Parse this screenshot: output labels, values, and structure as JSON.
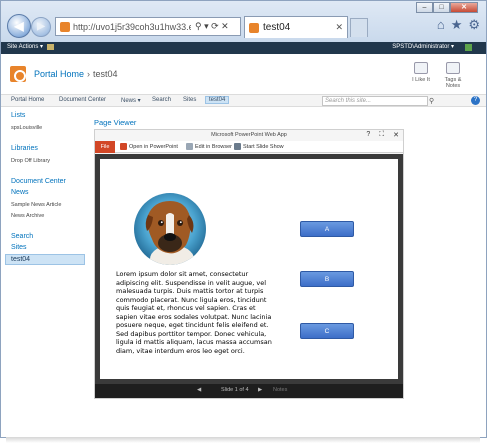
{
  "browser": {
    "url": "http://uvo1j5r39coh3u1hw33.env.c...",
    "address_icons": "⚲ ▾ ⟳ ✕",
    "tab_title": "test04",
    "window_buttons": [
      "–",
      "□",
      "✕"
    ],
    "icons": [
      "home-icon",
      "star-icon",
      "gear-icon"
    ]
  },
  "sp_topbar": {
    "site_actions": "Site Actions ▾",
    "user": "SPSTD\\Administrator ▾"
  },
  "title_area": {
    "site_title": "Portal Home",
    "separator": "›",
    "current_page": "test04",
    "ribbon_buttons": [
      {
        "label": "I Like It"
      },
      {
        "label": "Tags & Notes"
      }
    ]
  },
  "top_nav": {
    "items": [
      "Portal Home",
      "Document Center",
      "News ▾",
      "Search",
      "Sites",
      "test04"
    ],
    "selected": "test04",
    "search_placeholder": "Search this site...",
    "help": "?"
  },
  "quick_launch": {
    "sections": [
      {
        "heading": "Lists",
        "items": [
          "spsLouisville"
        ]
      },
      {
        "heading": "Libraries",
        "items": [
          "Drop Off Library"
        ]
      },
      {
        "heading": "Document Center",
        "items": []
      },
      {
        "heading": "News",
        "items": [
          "Sample News Article",
          "News Archive"
        ]
      },
      {
        "heading": "Search",
        "items": []
      },
      {
        "heading": "Sites",
        "items": []
      }
    ],
    "selected": "test04"
  },
  "web_part": {
    "title": "Page Viewer",
    "app_title": "Microsoft PowerPoint Web App",
    "header_icons": [
      "?",
      "⛶",
      "✕"
    ],
    "toolbar": {
      "file": "File",
      "open_in_powerpoint": "Open in PowerPoint",
      "edit_in_browser": "Edit in Browser",
      "start_slide_show": "Start Slide Show"
    },
    "slide": {
      "text": "Lorem ipsum dolor sit amet, consectetur adipiscing elit. Suspendisse in velit augue, vel malesuada turpis. Duis mattis tortor at turpis commodo placerat. Nunc ligula eros, tincidunt quis feugiat et, rhoncus vel sapien. Cras et sapien vitae eros sodales volutpat. Nunc lacinia posuere neque, eget tincidunt felis eleifend et. Sed dapibus porttitor tempor. Donec vehicula, ligula id mattis aliquam, lacus massa accumsan diam, vitae interdum eros leo eget orci.",
      "buttons": [
        "A",
        "B",
        "C"
      ]
    },
    "footer": {
      "prev": "◀",
      "next": "▶",
      "slide_counter": "Slide 1 of 4",
      "notes": "Notes"
    }
  }
}
